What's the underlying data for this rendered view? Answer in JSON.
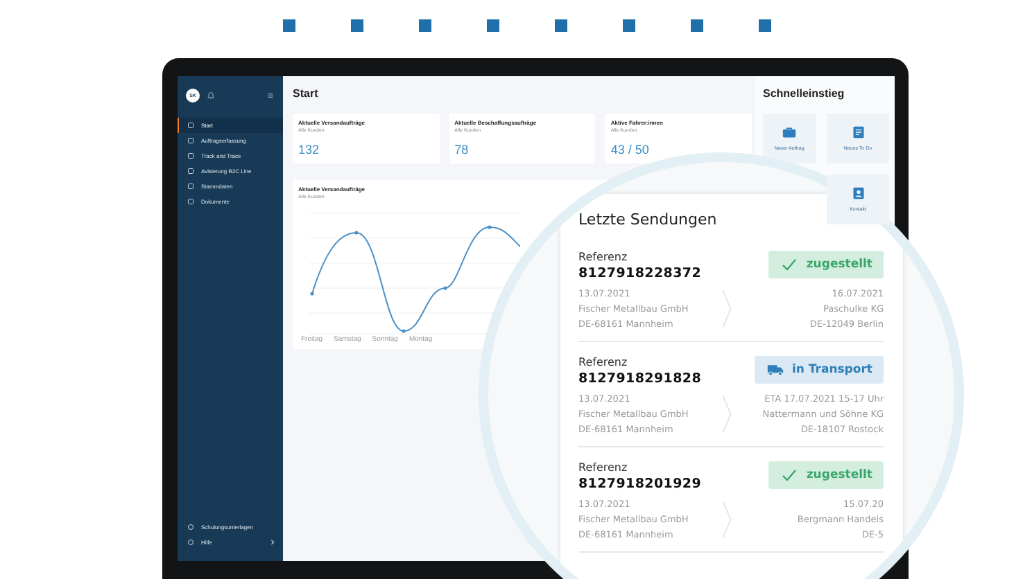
{
  "sidebar": {
    "avatar": "SK",
    "items": [
      {
        "label": "Start",
        "selected": true
      },
      {
        "label": "Auftragserfassung",
        "selected": false
      },
      {
        "label": "Track and Trace",
        "selected": false
      },
      {
        "label": "Avisierung B2C Line",
        "selected": false
      },
      {
        "label": "Stammdaten",
        "selected": false
      },
      {
        "label": "Dokumente",
        "selected": false
      }
    ],
    "footer_items": [
      {
        "label": "Schulungsunterlagen",
        "selected": false
      },
      {
        "label": "Hilfe",
        "selected": false
      }
    ]
  },
  "page_title": "Start",
  "stats": [
    {
      "title": "Aktuelle Versandaufträge",
      "subtitle": "Alle Kunden",
      "value": "132"
    },
    {
      "title": "Aktuelle Beschaffungsaufträge",
      "subtitle": "Alle Kunden",
      "value": "78"
    },
    {
      "title": "Aktive Fahrer:innen",
      "subtitle": "Alle Kunden",
      "value": "43 / 50"
    }
  ],
  "chart": {
    "title": "Aktuelle Versandaufträge",
    "subtitle": "Alle Kunden",
    "x_labels": [
      "Freitag",
      "Samstag",
      "Sonntag",
      "Montag"
    ]
  },
  "quick_access": {
    "title": "Schnelleinstieg",
    "tiles": [
      {
        "label": "Neuer Auftrag",
        "kind": "case"
      },
      {
        "label": "Neues To Do",
        "kind": "note"
      },
      {
        "label": "Kontakt",
        "kind": "contact"
      }
    ]
  },
  "shipments": {
    "title": "Letzte Sendungen",
    "items": [
      {
        "label": "Referenz",
        "reference": "8127918228372",
        "status": "zugestellt",
        "kind": "delivered",
        "from_date": "13.07.2021",
        "from_company": "Fischer Metallbau GmbH",
        "from_city": "DE-68161 Mannheim",
        "to_date": "16.07.2021",
        "to_company": "Paschulke KG",
        "to_city": "DE-12049 Berlin"
      },
      {
        "label": "Referenz",
        "reference": "8127918291828",
        "status": "in Transport",
        "kind": "transit",
        "from_date": "13.07.2021",
        "from_company": "Fischer Metallbau GmbH",
        "from_city": "DE-68161 Mannheim",
        "to_date": "ETA 17.07.2021 15-17 Uhr",
        "to_company": "Nattermann und Söhne KG",
        "to_city": "DE-18107 Rostock"
      },
      {
        "label": "Referenz",
        "reference": "8127918201929",
        "status": "zugestellt",
        "kind": "delivered",
        "from_date": "13.07.2021",
        "from_company": "Fischer Metallbau GmbH",
        "from_city": "DE-68161 Mannheim",
        "to_date": "15.07.20",
        "to_company": "Bergmann Handels",
        "to_city": "DE-5"
      }
    ]
  }
}
